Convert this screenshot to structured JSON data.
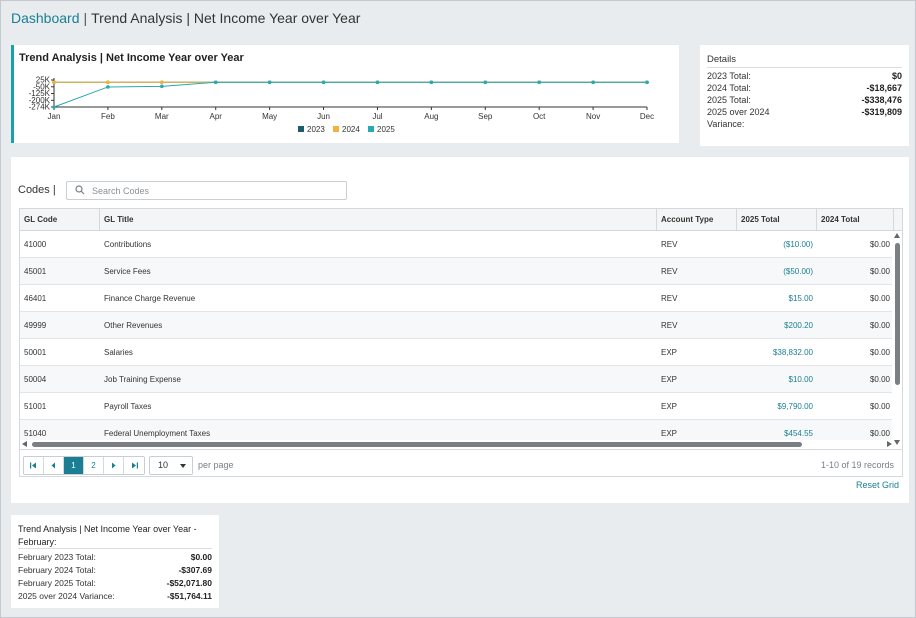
{
  "breadcrumb": {
    "root": "Dashboard",
    "separator": "|",
    "current": "Trend Analysis | Net Income Year over Year"
  },
  "chart_card": {
    "title": "Trend Analysis | Net Income Year over Year"
  },
  "chart_data": {
    "type": "line",
    "categories": [
      "Jan",
      "Feb",
      "Mar",
      "Apr",
      "May",
      "Jun",
      "Jul",
      "Aug",
      "Sep",
      "Oct",
      "Nov",
      "Dec"
    ],
    "y_ticks": [
      25000,
      -50000,
      -125000,
      -200000,
      -274000
    ],
    "y_tick_labels": [
      "25K",
      "-50K",
      "-125K",
      "-200K",
      "-274K"
    ],
    "ylim": [
      -274000,
      25000
    ],
    "series": [
      {
        "name": "2023",
        "color": "#1b5e6b",
        "values": [
          0,
          0,
          0,
          0,
          0,
          0,
          0,
          0,
          0,
          0,
          0,
          0
        ]
      },
      {
        "name": "2024",
        "color": "#f0b43c",
        "values": [
          0,
          0,
          0,
          0,
          0,
          0,
          0,
          0,
          0,
          0,
          0,
          0
        ]
      },
      {
        "name": "2025",
        "color": "#2aa8b4",
        "values": [
          -274000,
          -52000,
          -45000,
          0,
          0,
          0,
          0,
          0,
          0,
          0,
          0,
          0
        ]
      }
    ],
    "legend_position": "bottom-center",
    "grid": false
  },
  "details": {
    "title": "Details",
    "rows": [
      {
        "label": "2023 Total:",
        "value": "$0"
      },
      {
        "label": "2024 Total:",
        "value": "-$18,667"
      },
      {
        "label": "2025 Total:",
        "value": "-$338,476"
      },
      {
        "label": "2025 over 2024",
        "value": "-$319,809"
      },
      {
        "label": "Variance:",
        "value": ""
      }
    ]
  },
  "grid": {
    "codes_label": "Codes |",
    "search_placeholder": "Search Codes",
    "columns": [
      "GL Code",
      "GL Title",
      "Account Type",
      "2025 Total",
      "2024 Total"
    ],
    "rows": [
      {
        "code": "41000",
        "title": "Contributions",
        "type": "REV",
        "t2025": "($10.00)",
        "t2024": "$0.00"
      },
      {
        "code": "45001",
        "title": "Service Fees",
        "type": "REV",
        "t2025": "($50.00)",
        "t2024": "$0.00"
      },
      {
        "code": "46401",
        "title": "Finance Charge Revenue",
        "type": "REV",
        "t2025": "$15.00",
        "t2024": "$0.00"
      },
      {
        "code": "49999",
        "title": "Other Revenues",
        "type": "REV",
        "t2025": "$200.20",
        "t2024": "$0.00"
      },
      {
        "code": "50001",
        "title": "Salaries",
        "type": "EXP",
        "t2025": "$38,832.00",
        "t2024": "$0.00"
      },
      {
        "code": "50004",
        "title": "Job Training Expense",
        "type": "EXP",
        "t2025": "$10.00",
        "t2024": "$0.00"
      },
      {
        "code": "51001",
        "title": "Payroll Taxes",
        "type": "EXP",
        "t2025": "$9,790.00",
        "t2024": "$0.00"
      },
      {
        "code": "51040",
        "title": "Federal Unemployment Taxes",
        "type": "EXP",
        "t2025": "$454.55",
        "t2024": "$0.00"
      }
    ],
    "pager": {
      "first_icon": "first-page-icon",
      "prev_icon": "prev-page-icon",
      "next_icon": "next-page-icon",
      "last_icon": "last-page-icon",
      "pages": [
        "1",
        "2"
      ],
      "current_page": "1",
      "page_size": "10",
      "per_page_label": "per page",
      "records": "1-10 of 19 records"
    },
    "reset_label": "Reset Grid"
  },
  "mini_details": {
    "title": "Trend Analysis | Net Income Year over Year - February:",
    "rows": [
      {
        "label": "February 2023 Total:",
        "value": "$0.00"
      },
      {
        "label": "February 2024 Total:",
        "value": "-$307.69"
      },
      {
        "label": "February 2025 Total:",
        "value": "-$52,071.80"
      },
      {
        "label": "2025 over 2024 Variance:",
        "value": "-$51,764.11"
      }
    ]
  },
  "colors": {
    "accent": "#1a7f92",
    "chart_accent_bar": "#1aa0ac"
  }
}
